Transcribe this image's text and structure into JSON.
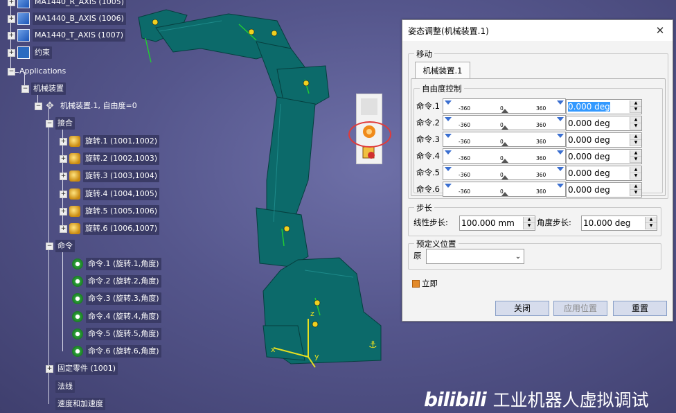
{
  "tree": {
    "top_items": [
      {
        "label": "MA1440_R_AXIS (1005)"
      },
      {
        "label": "MA1440_B_AXIS (1006)"
      },
      {
        "label": "MA1440_T_AXIS (1007)"
      },
      {
        "label": "约束"
      }
    ],
    "applications_label": "Applications",
    "mechanisms_label": "机械装置",
    "mechanism_label": "机械装置.1, 自由度=0",
    "joints_label": "接合",
    "joints": [
      "旋转.1 (1001,1002)",
      "旋转.2 (1002,1003)",
      "旋转.3 (1003,1004)",
      "旋转.4 (1004,1005)",
      "旋转.5 (1005,1006)",
      "旋转.6 (1006,1007)"
    ],
    "commands_label": "命令",
    "commands": [
      "命令.1 (旋转.1,角度)",
      "命令.2 (旋转.2,角度)",
      "命令.3 (旋转.3,角度)",
      "命令.4 (旋转.4,角度)",
      "命令.5 (旋转.5,角度)",
      "命令.6 (旋转.6,角度)"
    ],
    "fixed_part_label": "固定零件 (1001)",
    "laws_label": "法线",
    "speed_label": "速度和加速度"
  },
  "dialog": {
    "title": "姿态调整(机械装置.1)",
    "move_group": "移动",
    "tab_label": "机械装置.1",
    "dof_group": "自由度控制",
    "slider_min": "-360",
    "slider_mid": "0",
    "slider_max": "360",
    "rows": [
      {
        "label": "命令.1",
        "value": "0.000 deg"
      },
      {
        "label": "命令.2",
        "value": "0.000 deg"
      },
      {
        "label": "命令.3",
        "value": "0.000 deg"
      },
      {
        "label": "命令.4",
        "value": "0.000 deg"
      },
      {
        "label": "命令.5",
        "value": "0.000 deg"
      },
      {
        "label": "命令.6",
        "value": "0.000 deg"
      }
    ],
    "step_group": "步长",
    "linear_step_label": "线性步长:",
    "linear_step_value": "100.000 mm",
    "angle_step_label": "角度步长:",
    "angle_step_value": "10.000 deg",
    "preset_group": "预定义位置",
    "preset_label": "原",
    "preset_value": "",
    "immediate_label": "立即",
    "buttons": {
      "close": "关闭",
      "apply": "应用位置",
      "reset": "重置"
    }
  },
  "watermark": {
    "logo": "bilibili",
    "text": "工业机器人虚拟调试"
  },
  "colors": {
    "background": "#55568c",
    "robot": "#0c6a6a",
    "highlight": "#e03a3a"
  }
}
